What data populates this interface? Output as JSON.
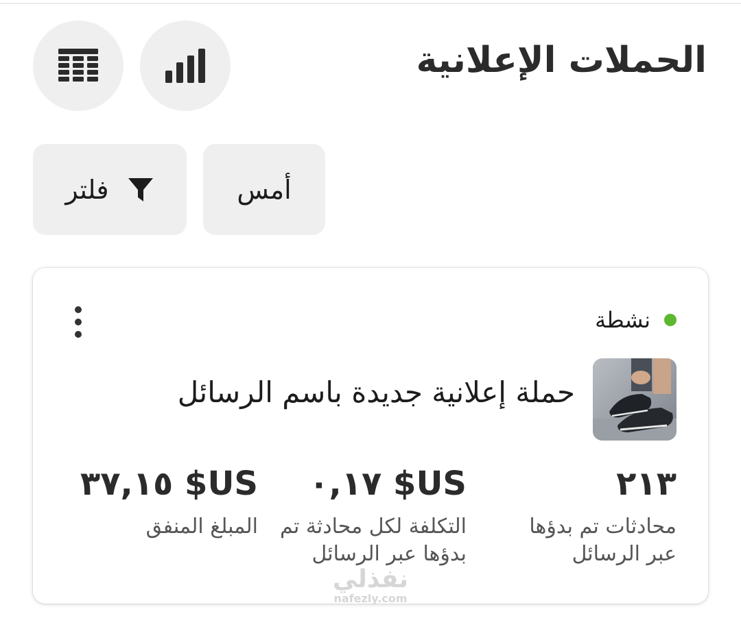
{
  "header": {
    "title": "الحملات الإعلانية",
    "chart_view_icon": "bar-chart-icon",
    "table_view_icon": "table-grid-icon"
  },
  "filters": {
    "date_label": "أمس",
    "filter_label": "فلتر",
    "filter_icon": "funnel-icon"
  },
  "campaign": {
    "status": "نشطة",
    "status_color": "#5cb82e",
    "name": "حملة إعلانية جديدة باسم الرسائل",
    "menu_icon": "more-vertical-icon",
    "thumbnail": "sneakers-photo",
    "metrics": [
      {
        "value": "٢١٣",
        "label": "محادثات تم بدؤها عبر الرسائل"
      },
      {
        "value": "US$ ٠,١٧",
        "label": "التكلفة لكل محادثة تم بدؤها عبر الرسائل"
      },
      {
        "value": "US$ ٣٧,١٥",
        "label": "المبلغ المنفق"
      }
    ]
  },
  "watermark": {
    "arabic": "نفذلي",
    "latin": "nafezly.com"
  }
}
